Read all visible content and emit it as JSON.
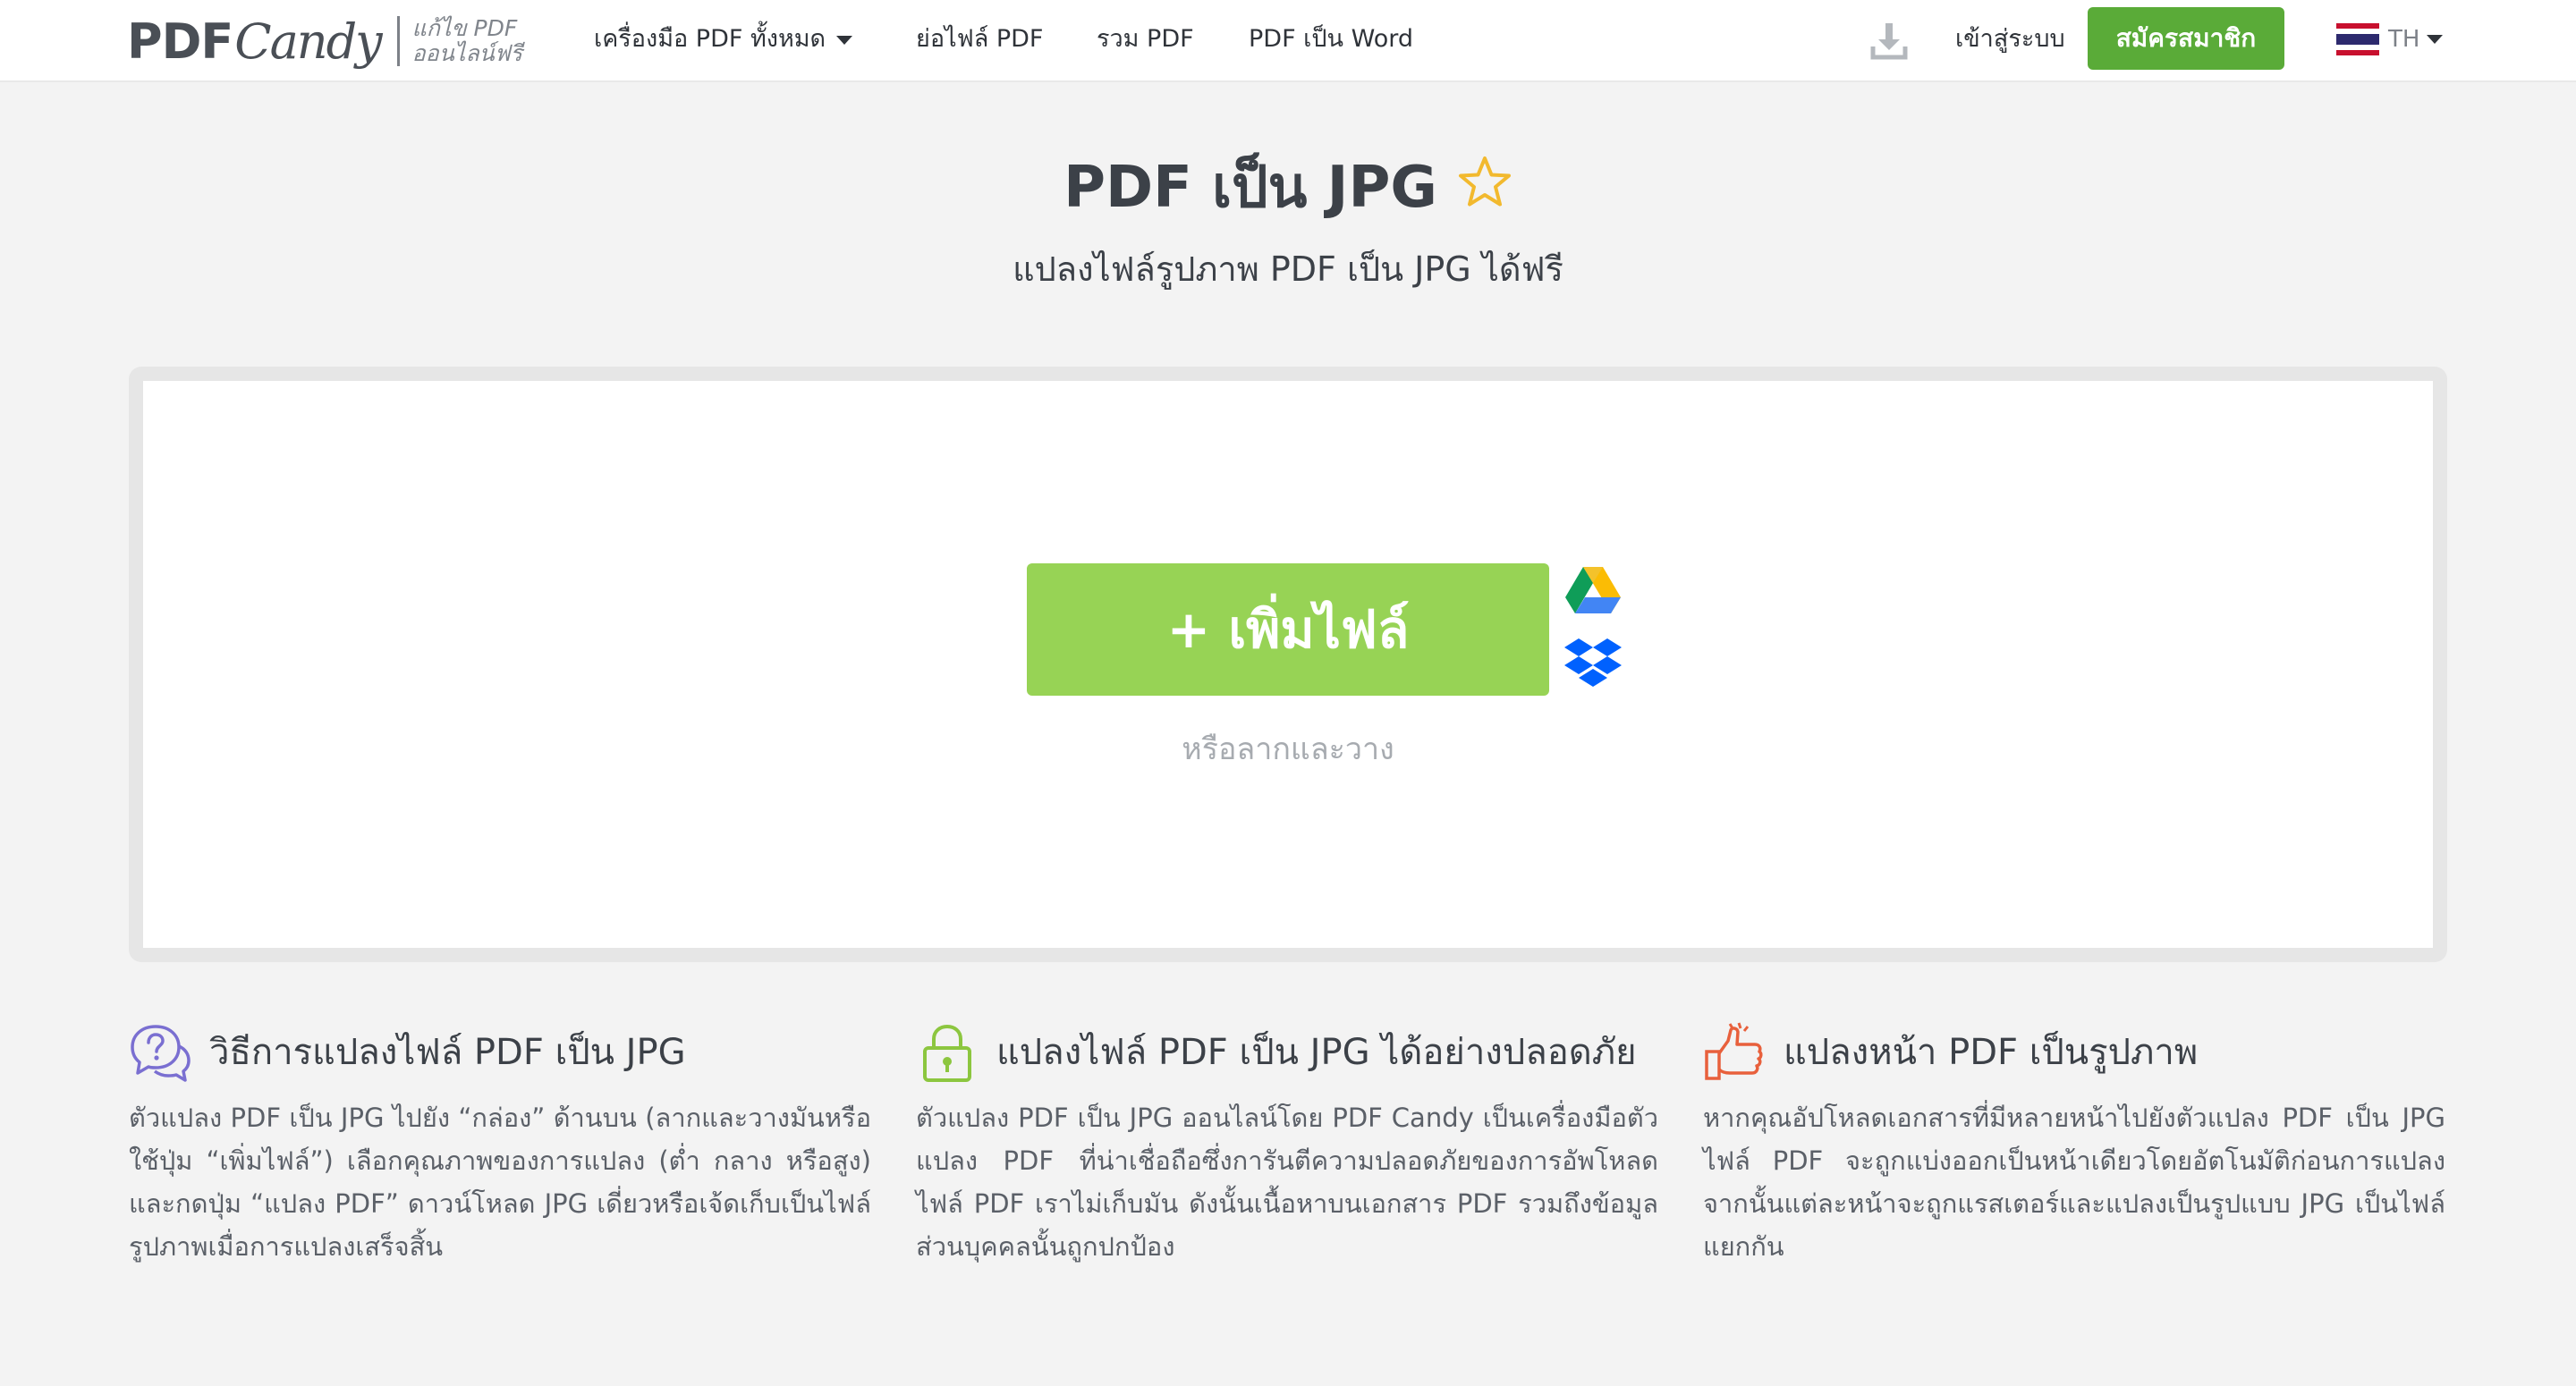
{
  "header": {
    "logo": {
      "brand_pdf": "PDF",
      "brand_candy": "Candy",
      "tagline_1": "แก้ไข PDF",
      "tagline_2": "ออนไลน์ฟรี"
    },
    "nav": {
      "all_tools": "เครื่องมือ PDF ทั้งหมด",
      "compress": "ย่อไฟล์ PDF",
      "merge": "รวม PDF",
      "pdf_to_word": "PDF เป็น Word"
    },
    "download_icon": "download-icon",
    "login": "เข้าสู่ระบบ",
    "signup": "สมัครสมาชิก",
    "language": "TH"
  },
  "hero": {
    "title": "PDF เป็น JPG",
    "subtitle": "แปลงไฟล์รูปภาพ PDF เป็น JPG ได้ฟรี",
    "favorite_icon": "star-icon"
  },
  "upload": {
    "add_file_label": "+ เพิ่มไฟล์",
    "drop_hint": "หรือลากและวาง",
    "sources": [
      "google-drive-icon",
      "dropbox-icon"
    ]
  },
  "info": [
    {
      "icon": "question-chat-icon",
      "title": "วิธีการแปลงไฟล์ PDF เป็น JPG",
      "text": "ตัวแปลง PDF เป็น JPG ไปยัง “กล่อง” ด้านบน (ลากและวางมันหรือใช้ปุ่ม “เพิ่มไฟล์”) เลือกคุณภาพของการแปลง (ต่ำ กลาง หรือสูง) และกดปุ่ม “แปลง PDF” ดาวน์โหลด JPG เดี่ยวหรือเจ้ดเก็บเป็นไฟล์รูปภาพเมื่อการแปลงเสร็จสิ้น"
    },
    {
      "icon": "lock-icon",
      "title": "แปลงไฟล์ PDF เป็น JPG ได้อย่างปลอดภัย",
      "text": "ตัวแปลง PDF เป็น JPG ออนไลน์โดย PDF Candy เป็นเครื่องมือตัวแปลง PDF ที่น่าเชื่อถือซึ่งการันตีความปลอดภัยของการอัพโหลดไฟล์ PDF เราไม่เก็บมัน ดังนั้นเนื้อหาบนเอกสาร PDF รวมถึงข้อมูลส่วนบุคคลนั้นถูกปกป้อง"
    },
    {
      "icon": "thumbs-up-icon",
      "title": "แปลงหน้า PDF เป็นรูปภาพ",
      "text": "หากคุณอัปโหลดเอกสารที่มีหลายหน้าไปยังตัวแปลง PDF เป็น JPG ไฟล์ PDF จะถูกแบ่งออกเป็นหน้าเดียวโดยอัตโนมัติก่อนการแปลง จากนั้นแต่ละหน้าจะถูกแรสเตอร์และแปลงเป็นรูปแบบ JPG เป็นไฟล์แยกกัน"
    }
  ],
  "colors": {
    "accent_green": "#5aab38",
    "upload_green": "#97d355",
    "star": "#f2b92e",
    "info_icon_purple": "#7a6fd1",
    "info_icon_green": "#8cc63f",
    "info_icon_orange": "#e8603c"
  }
}
